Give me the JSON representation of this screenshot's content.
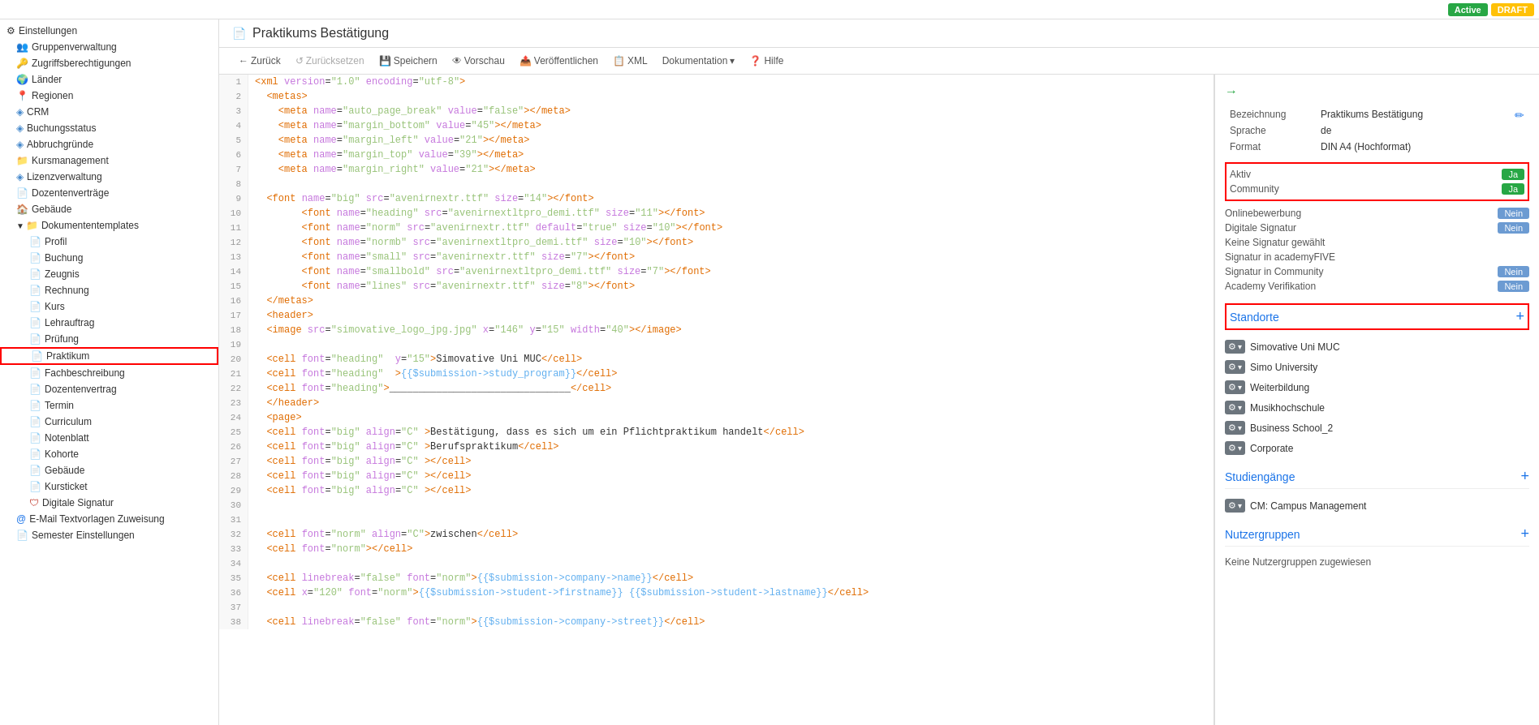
{
  "topbar": {
    "active_label": "Active",
    "draft_label": "DRAFT"
  },
  "sidebar": {
    "items": [
      {
        "id": "einstellungen",
        "label": "Einstellungen",
        "icon": "⚙",
        "level": 0,
        "expandable": true
      },
      {
        "id": "gruppenverwaltung",
        "label": "Gruppenverwaltung",
        "icon": "👥",
        "level": 1
      },
      {
        "id": "zugriffsberechtigungen",
        "label": "Zugriffsberechtigungen",
        "icon": "🔑",
        "level": 1
      },
      {
        "id": "lander",
        "label": "Länder",
        "icon": "🌍",
        "level": 1
      },
      {
        "id": "regionen",
        "label": "Regionen",
        "icon": "📍",
        "level": 1
      },
      {
        "id": "crm",
        "label": "CRM",
        "icon": "◈",
        "level": 1
      },
      {
        "id": "buchungsstatus",
        "label": "Buchungsstatus",
        "icon": "◈",
        "level": 1
      },
      {
        "id": "abbruchgrunde",
        "label": "Abbruchgründe",
        "icon": "◈",
        "level": 1
      },
      {
        "id": "kursmanagement",
        "label": "Kursmanagement",
        "icon": "📁",
        "level": 1
      },
      {
        "id": "lizenzverwaltung",
        "label": "Lizenzverwaltung",
        "icon": "◈",
        "level": 1
      },
      {
        "id": "dozentenvertrage",
        "label": "Dozentenverträge",
        "icon": "📄",
        "level": 1
      },
      {
        "id": "gebaude",
        "label": "Gebäude",
        "icon": "🏠",
        "level": 1
      },
      {
        "id": "dokumententemplates",
        "label": "Dokumententemplates",
        "icon": "📁",
        "level": 1,
        "expandable": true
      },
      {
        "id": "profil",
        "label": "Profil",
        "icon": "📄",
        "level": 2
      },
      {
        "id": "buchung",
        "label": "Buchung",
        "icon": "📄",
        "level": 2
      },
      {
        "id": "zeugnis",
        "label": "Zeugnis",
        "icon": "📄",
        "level": 2
      },
      {
        "id": "rechnung",
        "label": "Rechnung",
        "icon": "📄",
        "level": 2
      },
      {
        "id": "kurs",
        "label": "Kurs",
        "icon": "📄",
        "level": 2
      },
      {
        "id": "lehrauftrag",
        "label": "Lehrauftrag",
        "icon": "📄",
        "level": 2
      },
      {
        "id": "prufung",
        "label": "Prüfung",
        "icon": "📄",
        "level": 2
      },
      {
        "id": "praktikum",
        "label": "Praktikum",
        "icon": "📄",
        "level": 2,
        "selected": true,
        "highlighted": true
      },
      {
        "id": "fachbeschreibung",
        "label": "Fachbeschreibung",
        "icon": "📄",
        "level": 2
      },
      {
        "id": "dozentenvertrag2",
        "label": "Dozentenvertrag",
        "icon": "📄",
        "level": 2
      },
      {
        "id": "termin",
        "label": "Termin",
        "icon": "📄",
        "level": 2
      },
      {
        "id": "curriculum",
        "label": "Curriculum",
        "icon": "📄",
        "level": 2
      },
      {
        "id": "notenblatt",
        "label": "Notenblatt",
        "icon": "📄",
        "level": 2
      },
      {
        "id": "kohorte",
        "label": "Kohorte",
        "icon": "📄",
        "level": 2
      },
      {
        "id": "gebaude2",
        "label": "Gebäude",
        "icon": "📄",
        "level": 2
      },
      {
        "id": "kursticket",
        "label": "Kursticket",
        "icon": "📄",
        "level": 2
      },
      {
        "id": "digitale-signatur",
        "label": "Digitale Signatur",
        "icon": "🛡",
        "level": 2
      },
      {
        "id": "email-textvorlagen",
        "label": "E-Mail Textvorlagen Zuweisung",
        "icon": "@",
        "level": 1
      },
      {
        "id": "semester-einstellungen",
        "label": "Semester Einstellungen",
        "icon": "📄",
        "level": 1
      }
    ]
  },
  "page": {
    "title": "Praktikums Bestätigung",
    "doc_icon": "📄"
  },
  "toolbar": {
    "back_label": "Zurück",
    "reset_label": "Zurücksetzen",
    "save_label": "Speichern",
    "preview_label": "Vorschau",
    "publish_label": "Veröffentlichen",
    "xml_label": "XML",
    "documentation_label": "Dokumentation",
    "help_label": "Hilfe"
  },
  "xml_editor": {
    "lines": [
      {
        "num": 1,
        "content": "<xml version=\"1.0\" encoding=\"utf-8\">"
      },
      {
        "num": 2,
        "content": "  <metas>"
      },
      {
        "num": 3,
        "content": "    <meta name=\"auto_page_break\" value=\"false\"></meta>"
      },
      {
        "num": 4,
        "content": "    <meta name=\"margin_bottom\" value=\"45\"></meta>"
      },
      {
        "num": 5,
        "content": "    <meta name=\"margin_left\" value=\"21\"></meta>"
      },
      {
        "num": 6,
        "content": "    <meta name=\"margin_top\" value=\"39\"></meta>"
      },
      {
        "num": 7,
        "content": "    <meta name=\"margin_right\" value=\"21\"></meta>"
      },
      {
        "num": 8,
        "content": ""
      },
      {
        "num": 9,
        "content": "  <font name=\"big\" src=\"avenirnextr.ttf\" size=\"14\"></font>"
      },
      {
        "num": 10,
        "content": "        <font name=\"heading\" src=\"avenirnextltpro_demi.ttf\" size=\"11\"></font>"
      },
      {
        "num": 11,
        "content": "        <font name=\"norm\" src=\"avenirnextr.ttf\" default=\"true\" size=\"10\"></font>"
      },
      {
        "num": 12,
        "content": "        <font name=\"normb\" src=\"avenirnextltpro_demi.ttf\" size=\"10\"></font>"
      },
      {
        "num": 13,
        "content": "        <font name=\"small\" src=\"avenirnextr.ttf\" size=\"7\"></font>"
      },
      {
        "num": 14,
        "content": "        <font name=\"smallbold\" src=\"avenirnextltpro_demi.ttf\" size=\"7\"></font>"
      },
      {
        "num": 15,
        "content": "        <font name=\"lines\" src=\"avenirnextr.ttf\" size=\"8\"></font>"
      },
      {
        "num": 16,
        "content": "  </metas>"
      },
      {
        "num": 17,
        "content": "  <header>"
      },
      {
        "num": 18,
        "content": "  <image src=\"simovative_logo_jpg.jpg\" x=\"146\" y=\"15\" width=\"40\"></image>"
      },
      {
        "num": 19,
        "content": ""
      },
      {
        "num": 20,
        "content": "  <cell font=\"heading\"  y=\"15\">Simovative Uni MUC</cell>"
      },
      {
        "num": 21,
        "content": "  <cell font=\"heading\"  >{{$submission->study_program}}</cell>"
      },
      {
        "num": 22,
        "content": "  <cell font=\"heading\">_______________________________</cell>"
      },
      {
        "num": 23,
        "content": "  </header>"
      },
      {
        "num": 24,
        "content": "  <page>"
      },
      {
        "num": 25,
        "content": "  <cell font=\"big\" align=\"C\" >Bestätigung, dass es sich um ein Pflichtpraktikum handelt</cell>"
      },
      {
        "num": 26,
        "content": "  <cell font=\"big\" align=\"C\" >Berufspraktikum</cell>"
      },
      {
        "num": 27,
        "content": "  <cell font=\"big\" align=\"C\" ></cell>"
      },
      {
        "num": 28,
        "content": "  <cell font=\"big\" align=\"C\" ></cell>"
      },
      {
        "num": 29,
        "content": "  <cell font=\"big\" align=\"C\" ></cell>"
      },
      {
        "num": 30,
        "content": ""
      },
      {
        "num": 31,
        "content": ""
      },
      {
        "num": 32,
        "content": "  <cell font=\"norm\" align=\"C\">zwischen</cell>"
      },
      {
        "num": 33,
        "content": "  <cell font=\"norm\"></cell>"
      },
      {
        "num": 34,
        "content": ""
      },
      {
        "num": 35,
        "content": "  <cell linebreak=\"false\" font=\"norm\">{{$submission->company->name}}</cell>"
      },
      {
        "num": 36,
        "content": "  <cell x=\"120\" font=\"norm\">{{$submission->student->firstname}} {{$submission->student->lastname}}</cell>"
      },
      {
        "num": 37,
        "content": ""
      },
      {
        "num": 38,
        "content": "  <cell linebreak=\"false\" font=\"norm\">{{$submission->company->street}}</cell>"
      }
    ]
  },
  "right_panel": {
    "arrow": "→",
    "fields": [
      {
        "label": "Bezeichnung",
        "value": "Praktikums Bestätigung"
      },
      {
        "label": "Sprache",
        "value": "de"
      },
      {
        "label": "Format",
        "value": "DIN A4 (Hochformat)"
      }
    ],
    "aktiv": {
      "label": "Aktiv",
      "value": "Ja",
      "type": "yes"
    },
    "community": {
      "label": "Community",
      "value": "Ja",
      "type": "yes"
    },
    "extra_fields": [
      {
        "label": "Onlinebewerbung",
        "value": "Nein",
        "type": "no"
      },
      {
        "label": "Digitale Signatur",
        "value": "Nein",
        "type": "no"
      },
      {
        "label": "Keine Signatur gewählt",
        "value": ""
      },
      {
        "label": "Signatur in academyFIVE",
        "value": ""
      },
      {
        "label": "Signatur in Community",
        "value": "Nein",
        "type": "no"
      },
      {
        "label": "Academy Verifikation",
        "value": "Nein",
        "type": "no"
      }
    ],
    "standorte": {
      "title": "Standorte",
      "add_label": "+",
      "items": [
        "Simovative Uni MUC",
        "Simo University",
        "Weiterbildung",
        "Musikhochschule",
        "Business School_2",
        "Corporate"
      ]
    },
    "studiengange": {
      "title": "Studiengänge",
      "add_label": "+",
      "items": [
        "CM: Campus Management"
      ]
    },
    "nutzergruppen": {
      "title": "Nutzergruppen",
      "add_label": "+",
      "empty_label": "Keine Nutzergruppen zugewiesen"
    }
  }
}
